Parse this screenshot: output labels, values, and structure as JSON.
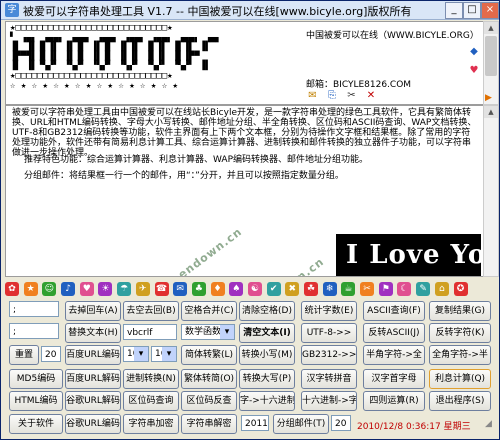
{
  "window": {
    "title": "被爱可以字符串处理工具 V1.7 -- 中国被爱可以在线[www.bicyle.org]版权所有",
    "buttons": {
      "minimize": "_",
      "maximize": "□",
      "close": "×"
    }
  },
  "banner": {
    "art_lines": [
      "★□□□□□□□□□□□□□□□□□□□□□□□□□□□□★",
      "▘ ▗▄▖ ▗▄▄▖ ▗▄▄▖ ▗▄▄▖ ▗▄▄▖ ▗▄▄▖ ▗▄▄▖ ▗▄▖",
      "▐▌ ▐▌▐▌▐▌ ▐▌▐▌ ▐▌▐▌ ▐▌▐▌ ▐▌▐▌ ▐▌▐▌ ▐▌",
      "▐▛▀▜▌▐▌▐▌ ▐▌▐▌ ▐▌▐▌ ▐▌▐▌ ▐▌▐▌ ▐▌▐▛▀",
      "▐▌ ▐▌▝▚▞▘ ▝▚▞▘ ▝▚▞▘ ▝▚▞▘ ▝▚▞▘ ▝▚▞▘ ▐▌",
      "★□□□□□□□□□□□□□□□□□□□□□□□□□□□□★",
      "☆ ★ ☆ ★ ☆ ★ ☆ ★ ☆ ★ ☆ ★ ☆ ★ ☆ ★"
    ],
    "site_text": "中国被爱可以在线（WWW.BICYLE.ORG）",
    "email_text": "邮箱：BICYLE8126.COM"
  },
  "text": {
    "intro": "被爱可以字符串处理工具由中国被爱可以在线站长Bicyle开发，是一款字符串处理的绿色工具软件，它具有繁简体转换、URL和HTML编码转换、字母大小写转换、邮件地址分组、半全角转换、区位码和ASCII码查询、WAP文档转换、UTF-8和GB2312编码转换等功能，软件主界面有上下两个文本框，分别为待操作文字框和结果框。除了常用的字符处理功能外，软件还带有简易利息计算工具、综合运算计算器、进制转换和邮件转换的独立器件子功能，可以字符串做进一步操作处理。",
    "recommend": "推荐特色功能：综合运算计算器、利息计算器、WAP编码转换器、邮件地址分组功能。",
    "group_mail": "分组邮件：将结果框一行一个的邮件，用“：”分开，并且可以按照指定数量分组。",
    "watermark1": "Greendown.cn",
    "watermark2": "Greendown.cn",
    "love": "I Love You"
  },
  "emoji_colors": [
    "#E03030",
    "#F08020",
    "#30A030",
    "#2060C0",
    "#E05090",
    "#A030C0",
    "#30A0A0",
    "#D0A020",
    "#E03030",
    "#2060C0",
    "#30A030",
    "#F08020",
    "#A030C0",
    "#E05090",
    "#30A0A0",
    "#D0A020",
    "#E03030",
    "#2060C0",
    "#30A030",
    "#F08020",
    "#A030C0",
    "#E05090",
    "#30A0A0",
    "#D0A020",
    "#E03030"
  ],
  "controls": {
    "row1": {
      "input1": ";",
      "btn_remove_return": "去掉回车(A)",
      "btn_remove_space": "去空去回(B)",
      "btn_space_merge": "空格合并(C)",
      "btn_clear_space": "清除空格(D)",
      "btn_stat_chars": "统计字数(E)",
      "btn_ascii_query": "ASCII查询(F)",
      "btn_copy_result": "复制结果(G)"
    },
    "row2": {
      "input2": ";",
      "btn_replace_text": "替换文本(H)",
      "input3": "vbcrlf",
      "select_func": "数学函数",
      "btn_clear_text": "清空文本(I)",
      "btn_utf8": "UTF-8->>",
      "btn_reverse_ascii": "反转ASCII(J)",
      "btn_reverse_chars": "反转字符(K)"
    },
    "row3": {
      "btn_repeat": "重置",
      "input_repeat": "20",
      "btn_baidu_url_encode": "百度URL编码",
      "select_10": "10",
      "select_16": "16",
      "btn_simp_trad": "简体转繁(L)",
      "btn_to_lower": "转换小写(M)",
      "btn_gb2312": "GB2312->>",
      "btn_half_full": "半角字符->全",
      "btn_full_half": "全角字符->半"
    },
    "row4": {
      "btn_md5": "MD5编码",
      "btn_baidu_url_decode": "百度URL解码",
      "btn_base_convert": "进制转换(N)",
      "btn_trad_simp": "繁体转简(O)",
      "btn_to_upper": "转换大写(P)",
      "btn_chinese_pinyin": "汉字转拼音",
      "btn_chinese_initial": "汉字首字母",
      "btn_interest_calc": "利息计算(Q)"
    },
    "row5": {
      "btn_html_encode": "HTML编码",
      "btn_google_url_decode": "谷歌URL解码",
      "btn_area_code": "区位码查询",
      "btn_area_reverse": "区位码反查",
      "btn_char_hex": "字->十六进制",
      "btn_hex_char": "十六进制->字",
      "btn_four_arith": "四则运算(R)",
      "btn_exit": "退出程序(S)"
    },
    "row6": {
      "btn_about": "关于软件",
      "btn_google_url_encode": "谷歌URL编码",
      "btn_str_encrypt": "字符串加密",
      "btn_str_decrypt": "字符串解密",
      "input_year": "2011",
      "btn_group_mail": "分组邮件(T)",
      "input_group": "20",
      "status_time": "2010/12/8 0:36:17 星期三"
    }
  }
}
